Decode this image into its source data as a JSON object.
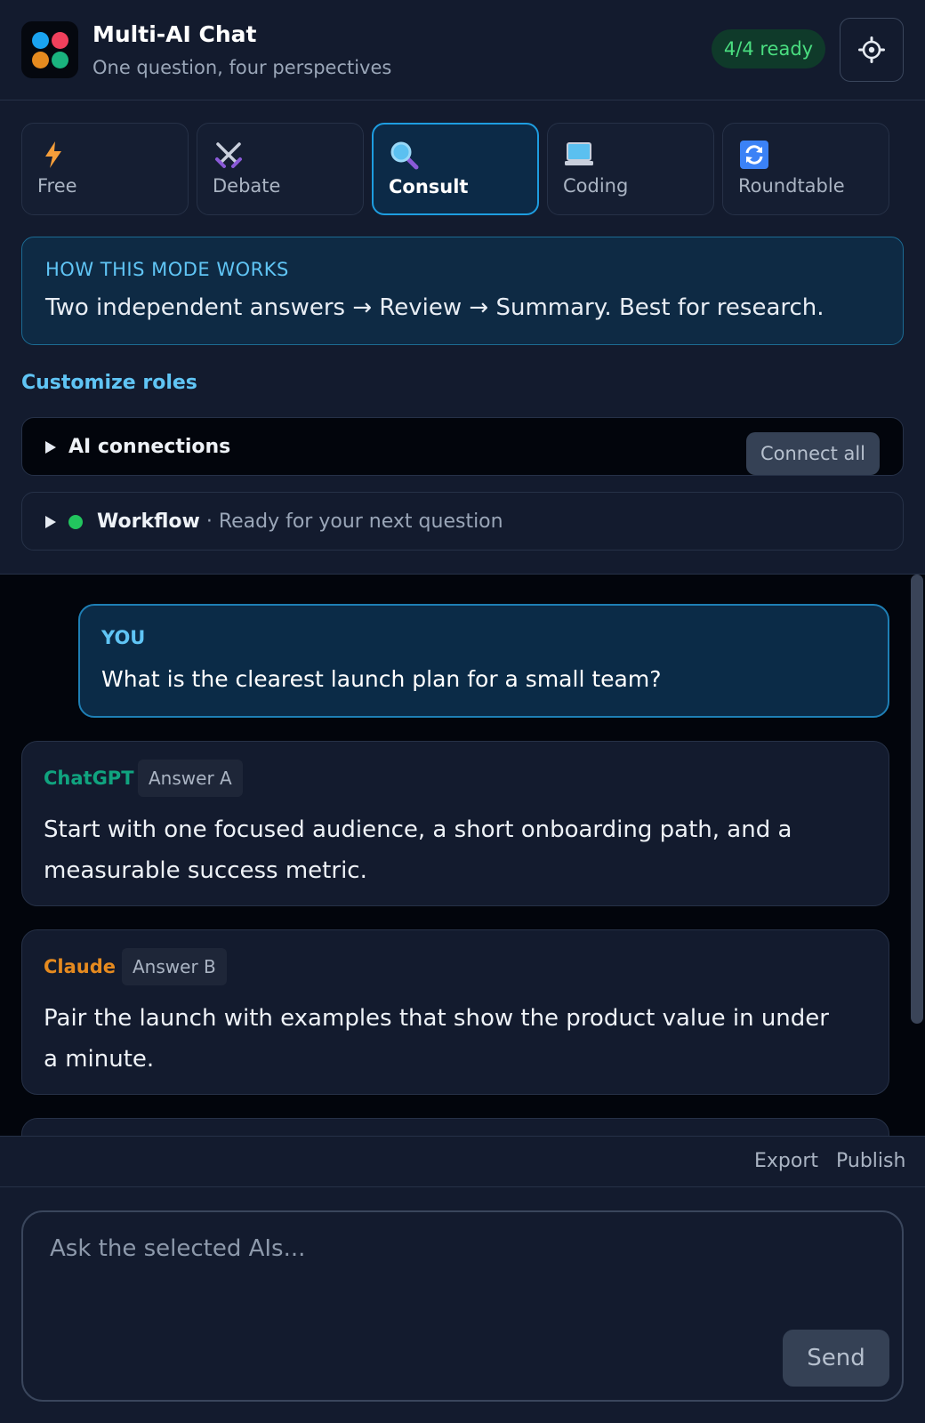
{
  "header": {
    "title": "Multi-AI Chat",
    "subtitle": "One question, four perspectives",
    "status_badge": "4/4 ready",
    "settings_icon": "gear-icon"
  },
  "modes": [
    {
      "label": "Free",
      "icon": "lightning-icon",
      "active": false
    },
    {
      "label": "Debate",
      "icon": "crossed-swords-icon",
      "active": false
    },
    {
      "label": "Consult",
      "icon": "magnifier-icon",
      "active": true
    },
    {
      "label": "Coding",
      "icon": "laptop-icon",
      "active": false
    },
    {
      "label": "Roundtable",
      "icon": "refresh-icon",
      "active": false
    }
  ],
  "info": {
    "title": "HOW THIS MODE WORKS",
    "text": "Two independent answers → Review → Summary. Best for research."
  },
  "customize_link": "Customize roles",
  "connections": {
    "label": "AI connections",
    "button": "Connect all"
  },
  "workflow": {
    "label": "Workflow",
    "status": "· Ready for your next question",
    "status_color": "#22c55e"
  },
  "chat": {
    "user": {
      "label": "YOU",
      "text": "What is the clearest launch plan for a small team?"
    },
    "answers": [
      {
        "ai": "ChatGPT",
        "color": "#10a37f",
        "badge": "Answer A",
        "text": "Start with one focused audience, a short onboarding path, and a measurable success metric."
      },
      {
        "ai": "Claude",
        "color": "#e58a1f",
        "badge": "Answer B",
        "text": "Pair the launch with examples that show the product value in under a minute."
      }
    ]
  },
  "footer": {
    "export": "Export",
    "publish": "Publish"
  },
  "composer": {
    "placeholder": "Ask the selected AIs...",
    "send": "Send"
  },
  "colors": {
    "accent": "#1e9de0",
    "background": "#131b2e",
    "chat_background": "#02050c"
  }
}
